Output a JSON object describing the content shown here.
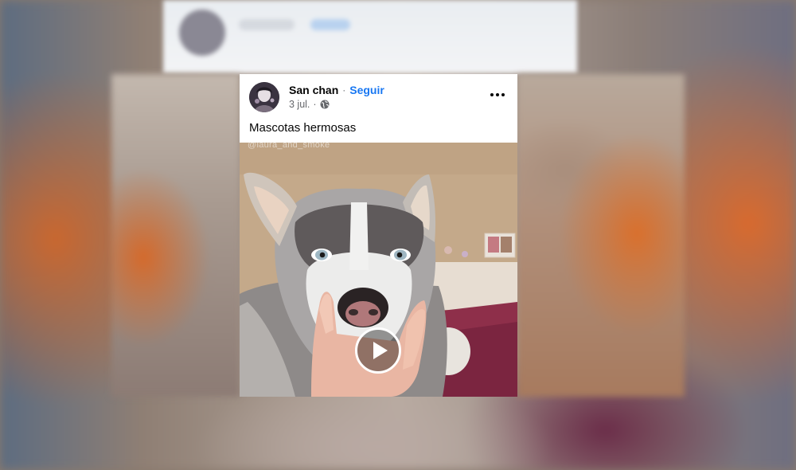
{
  "post": {
    "author_name": "San chan",
    "dot": "·",
    "follow_label": "Seguir",
    "date": "3 jul.",
    "meta_sep": "·",
    "caption": "Mascotas hermosas",
    "privacy_icon": "globe-icon",
    "more_icon": "more-options-icon"
  },
  "video": {
    "watermark": "@laura_and_smoke",
    "play_icon": "play-icon"
  },
  "colors": {
    "link": "#1877f2",
    "text_primary": "#050505",
    "text_secondary": "#65676b"
  }
}
